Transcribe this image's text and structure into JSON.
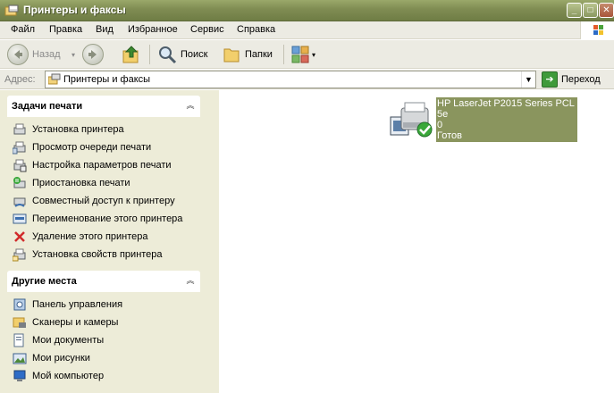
{
  "window": {
    "title": "Принтеры и факсы",
    "controls": {
      "minimize": "_",
      "maximize": "□",
      "close": "✕"
    }
  },
  "menu": [
    "Файл",
    "Правка",
    "Вид",
    "Избранное",
    "Сервис",
    "Справка"
  ],
  "toolbar": {
    "back_label": "Назад",
    "search_label": "Поиск",
    "folders_label": "Папки"
  },
  "address": {
    "label": "Адрес:",
    "value": "Принтеры и факсы",
    "go_label": "Переход"
  },
  "printer_tasks": {
    "title": "Задачи печати",
    "items": [
      {
        "label": "Установка принтера",
        "icon": "add-printer-icon"
      },
      {
        "label": "Просмотр очереди печати",
        "icon": "print-queue-icon"
      },
      {
        "label": "Настройка параметров печати",
        "icon": "printing-preferences-icon"
      },
      {
        "label": "Приостановка печати",
        "icon": "pause-printing-icon"
      },
      {
        "label": "Совместный доступ к принтеру",
        "icon": "share-printer-icon"
      },
      {
        "label": "Переименование этого принтера",
        "icon": "rename-printer-icon"
      },
      {
        "label": "Удаление этого принтера",
        "icon": "delete-icon"
      },
      {
        "label": "Установка свойств принтера",
        "icon": "printer-properties-icon"
      }
    ]
  },
  "other_places": {
    "title": "Другие места",
    "items": [
      {
        "label": "Панель управления",
        "icon": "control-panel-icon"
      },
      {
        "label": "Сканеры и камеры",
        "icon": "scanners-cameras-icon"
      },
      {
        "label": "Мои документы",
        "icon": "my-documents-icon"
      },
      {
        "label": "Мои рисунки",
        "icon": "my-pictures-icon"
      },
      {
        "label": "Мой компьютер",
        "icon": "my-computer-icon"
      }
    ]
  },
  "printer": {
    "name_line1": "HP LaserJet P2015 Series PCL 5e",
    "name_line2": "0",
    "status": "Готов"
  },
  "colors": {
    "titlebar": "#7f8c52",
    "selection": "#8a955e",
    "taskpane": "#edecd8"
  }
}
